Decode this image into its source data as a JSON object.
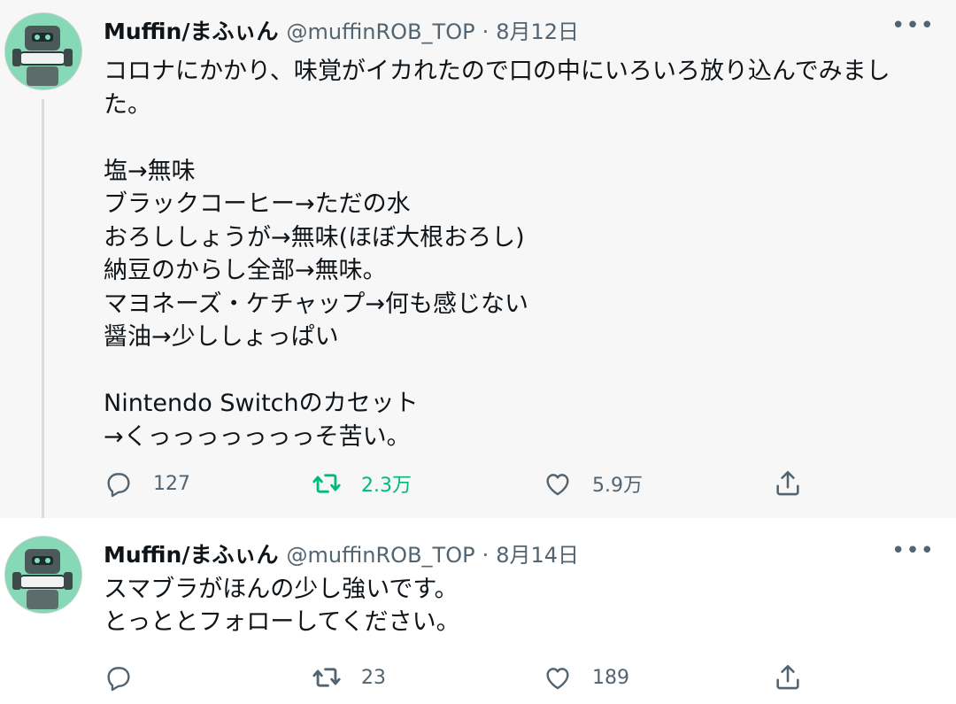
{
  "tweets": [
    {
      "name": "Muffin/まふぃん",
      "handle": "@muffinROB_TOP",
      "separator": "·",
      "date": "8月12日",
      "more": "•••",
      "text": "コロナにかかり、味覚がイカれたので口の中にいろいろ放り込んでみまし\nた。\n\n塩→無味\nブラックコーヒー→ただの水\nおろししょうが→無味(ほぼ大根おろし)\n納豆のからし全部→無味。\nマヨネーズ・ケチャップ→何も感じない\n醤油→少ししょっぱい\n\nNintendo Switchのカセット\n→くっっっっっっっそ苦い。",
      "replies": "127",
      "retweets": "2.3万",
      "likes": "5.9万",
      "retweeted": true
    },
    {
      "name": "Muffin/まふぃん",
      "handle": "@muffinROB_TOP",
      "separator": "·",
      "date": "8月14日",
      "more": "•••",
      "text": "スマブラがほんの少し強いです。\nとっととフォローしてください。",
      "replies": "",
      "retweets": "23",
      "likes": "189",
      "retweeted": false
    }
  ],
  "icons": {
    "reply": "reply-icon",
    "retweet": "retweet-icon",
    "like": "heart-icon",
    "share": "share-icon"
  },
  "colors": {
    "retweet_active": "#00ba7c",
    "muted": "#536471",
    "text": "#0f1419"
  }
}
